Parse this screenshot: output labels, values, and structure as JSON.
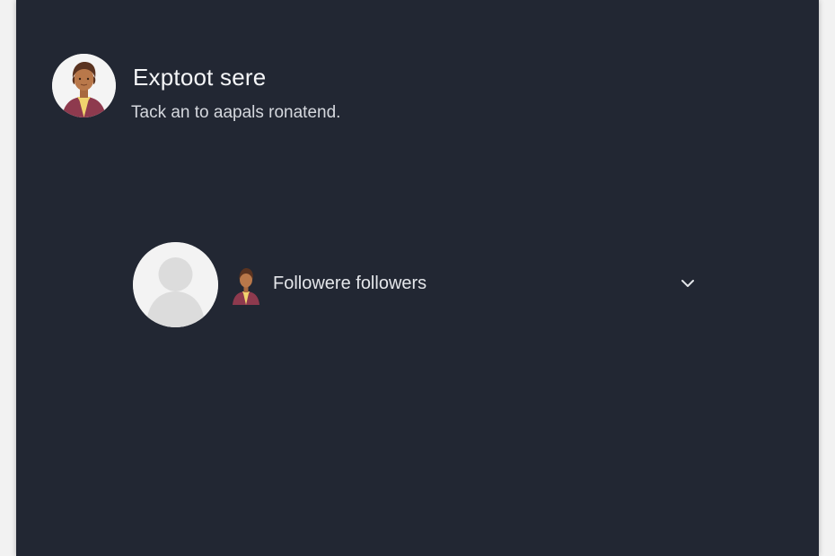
{
  "header": {
    "title": "Exptoot sere",
    "subtitle": "Tack an to aapals ronatend."
  },
  "follower_selector": {
    "label": "Followere followers",
    "expand_icon": "chevron-down-icon"
  },
  "icons": {
    "header_avatar": "person-avatar-icon",
    "placeholder_avatar": "default-user-icon",
    "follower_icon": "person-icon"
  },
  "colors": {
    "background": "#222733",
    "title": "#f4f5f7",
    "text": "#e4e6ea",
    "avatar_shirt": "#8e3a4e",
    "avatar_skin": "#b9784a"
  }
}
